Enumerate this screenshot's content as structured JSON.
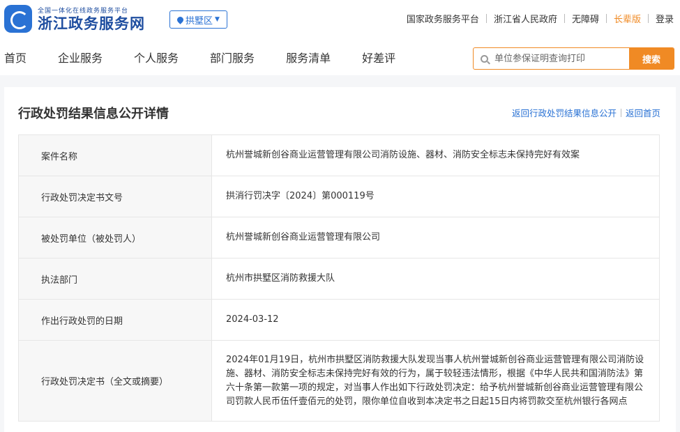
{
  "header": {
    "logo_subtitle": "全国一体化在线政务服务平台",
    "logo_title": "浙江政务服务网",
    "region": "拱墅区",
    "links": [
      "国家政务服务平台",
      "浙江省人民政府",
      "无障碍",
      "长辈版",
      "登录"
    ],
    "highlight_color": "#f08a24"
  },
  "nav": {
    "items": [
      "首页",
      "企业服务",
      "个人服务",
      "部门服务",
      "服务清单",
      "好差评"
    ]
  },
  "search": {
    "placeholder": "单位参保证明查询打印",
    "button_label": "搜索"
  },
  "page": {
    "title": "行政处罚结果信息公开详情",
    "back_link": "返回行政处罚结果信息公开",
    "home_link": "返回首页",
    "link_color": "#2a72d4"
  },
  "details": [
    {
      "label": "案件名称",
      "value": "杭州誉城新创谷商业运营管理有限公司消防设施、器材、消防安全标志未保持完好有效案"
    },
    {
      "label": "行政处罚决定书文号",
      "value": "拱消行罚决字〔2024〕第000119号"
    },
    {
      "label": "被处罚单位（被处罚人）",
      "value": "杭州誉城新创谷商业运营管理有限公司"
    },
    {
      "label": "执法部门",
      "value": "杭州市拱墅区消防救援大队"
    },
    {
      "label": "作出行政处罚的日期",
      "value": "2024-03-12"
    },
    {
      "label": "行政处罚决定书（全文或摘要）",
      "value": "2024年01月19日，杭州市拱墅区消防救援大队发现当事人杭州誉城新创谷商业运营管理有限公司消防设施、器材、消防安全标志未保持完好有效的行为，属于较轻违法情形，根据《中华人民共和国消防法》第六十条第一款第一项的规定，对当事人作出如下行政处罚决定：给予杭州誉城新创谷商业运营管理有限公司罚款人民币伍仟壹佰元的处罚，限你单位自收到本决定书之日起15日内将罚款交至杭州银行各网点"
    }
  ]
}
